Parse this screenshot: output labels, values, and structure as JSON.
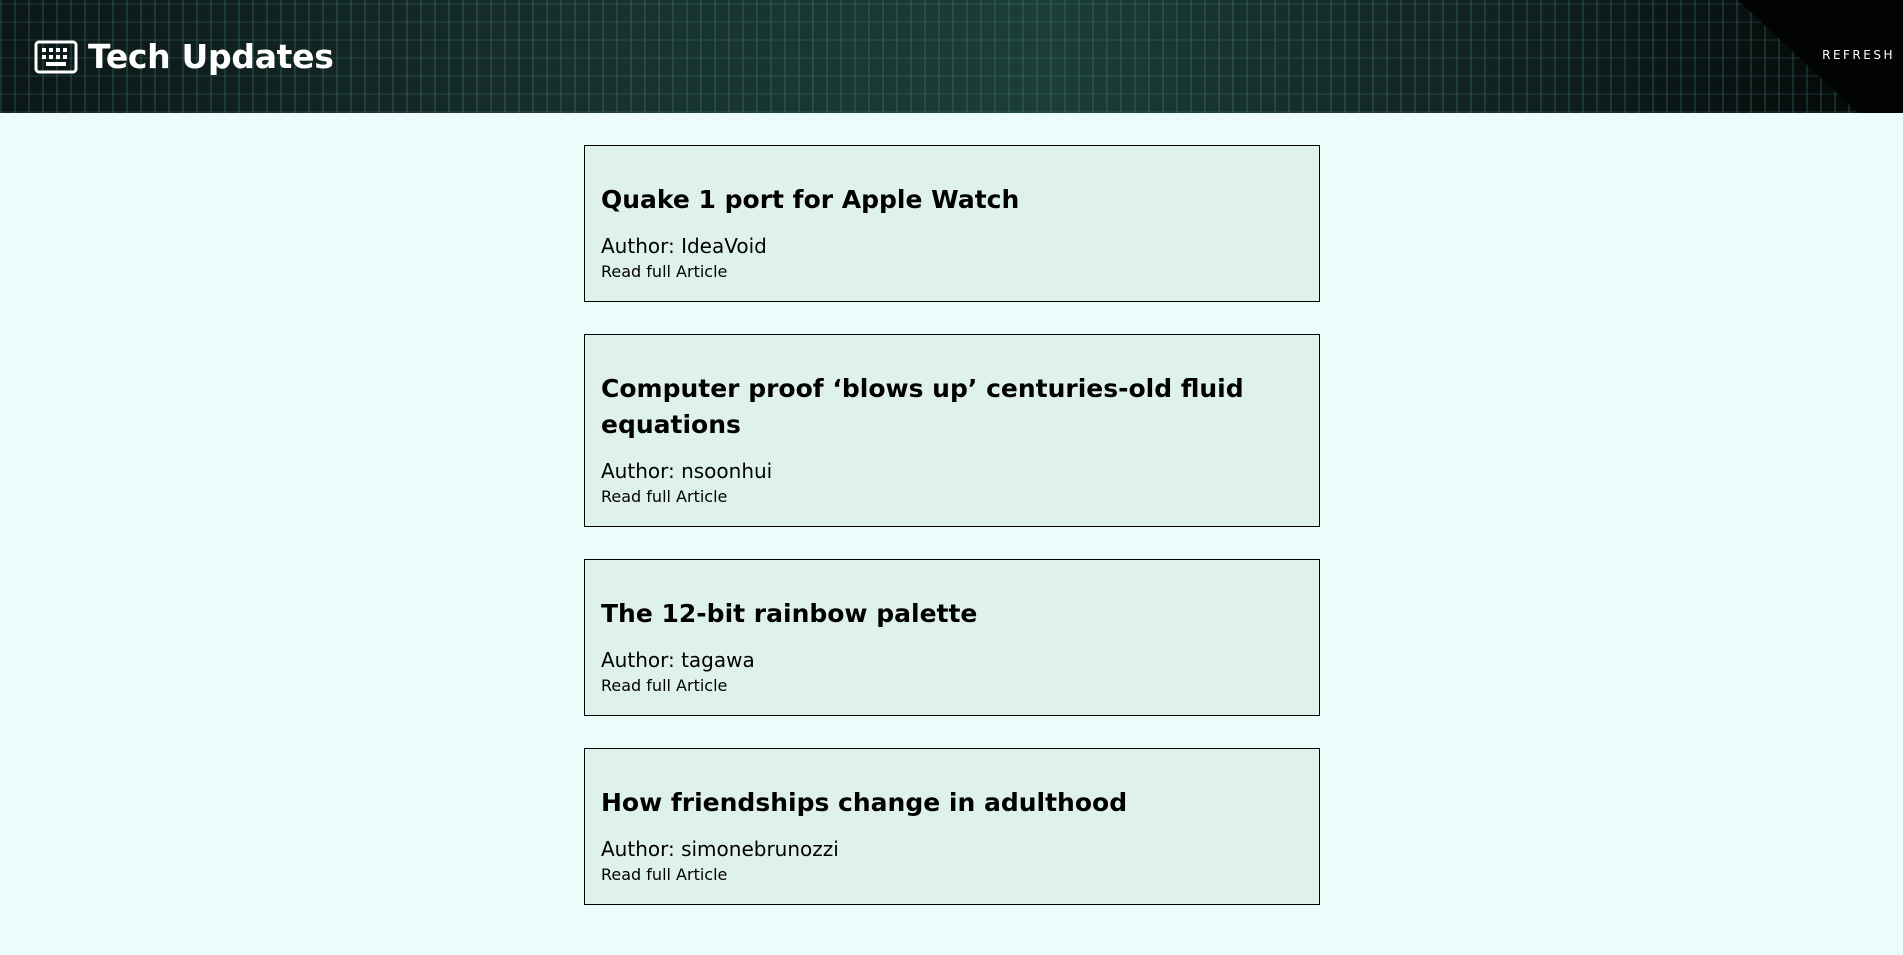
{
  "header": {
    "title": "Tech Updates",
    "logo_icon": "keyboard-icon",
    "refresh_label": "REFRESH"
  },
  "colors": {
    "page_background": "#ebfcfa",
    "card_background": "#dff2e9",
    "header_background": "#10211f",
    "text": "#000000"
  },
  "articles": [
    {
      "title": "Quake 1 port for Apple Watch",
      "author": "Author: IdeaVoid",
      "link_label": "Read full Article"
    },
    {
      "title": "Computer proof ‘blows up’ centuries-old fluid equations",
      "author": "Author: nsoonhui",
      "link_label": "Read full Article"
    },
    {
      "title": "The 12-bit rainbow palette",
      "author": "Author: tagawa",
      "link_label": "Read full Article"
    },
    {
      "title": "How friendships change in adulthood",
      "author": "Author: simonebrunozzi",
      "link_label": "Read full Article"
    }
  ]
}
